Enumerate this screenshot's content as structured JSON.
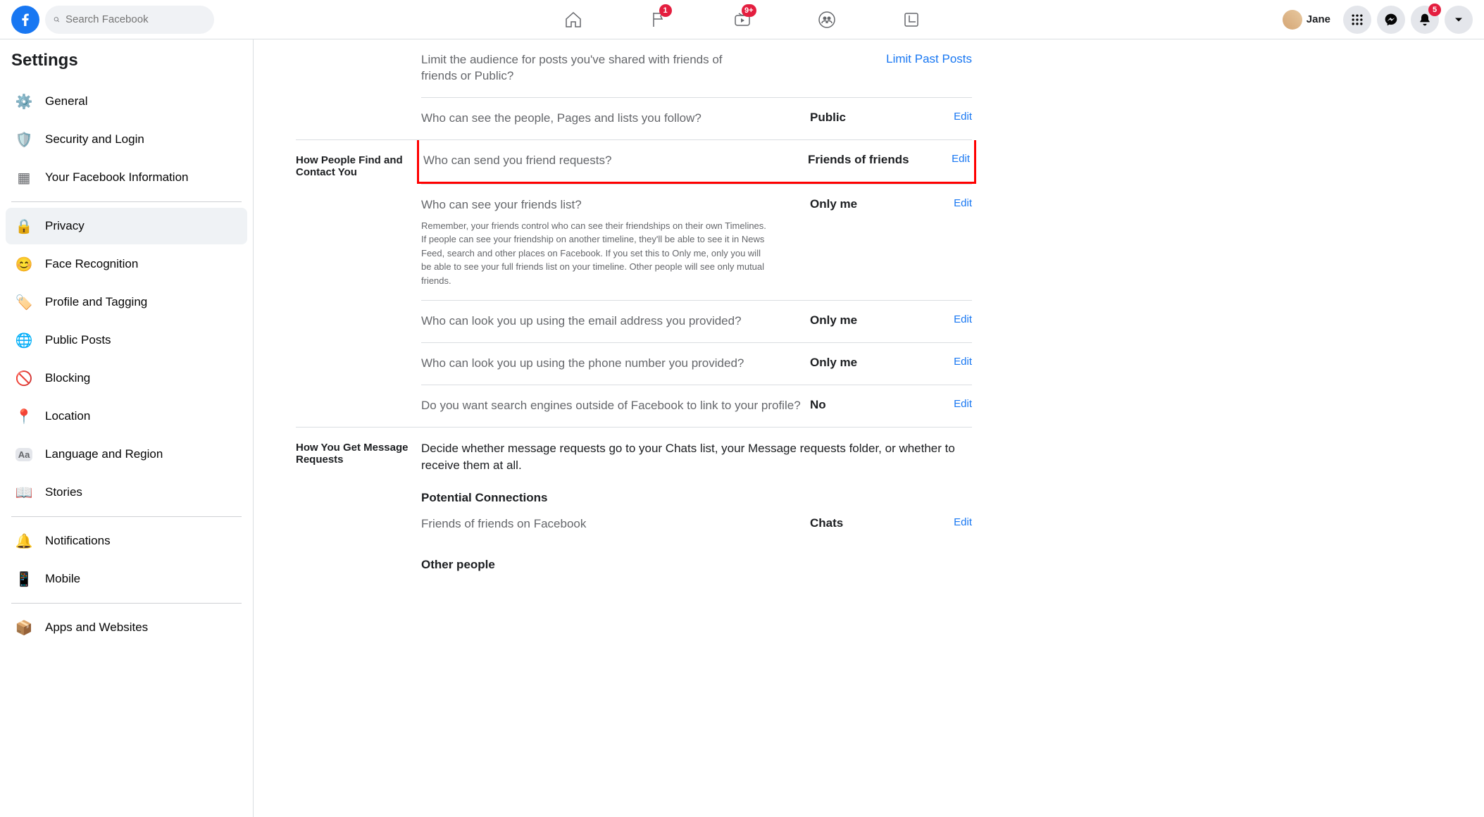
{
  "search": {
    "placeholder": "Search Facebook"
  },
  "badges": {
    "flag": "1",
    "watch": "9+",
    "notifications": "5"
  },
  "profile": {
    "name": "Jane"
  },
  "sidebar": {
    "title": "Settings",
    "items": [
      {
        "label": "General",
        "icon": "gear"
      },
      {
        "label": "Security and Login",
        "icon": "shield"
      },
      {
        "label": "Your Facebook Information",
        "icon": "grid"
      },
      {
        "label": "Privacy",
        "icon": "lock",
        "active": true
      },
      {
        "label": "Face Recognition",
        "icon": "face"
      },
      {
        "label": "Profile and Tagging",
        "icon": "tag"
      },
      {
        "label": "Public Posts",
        "icon": "globe"
      },
      {
        "label": "Blocking",
        "icon": "block"
      },
      {
        "label": "Location",
        "icon": "pin"
      },
      {
        "label": "Language and Region",
        "icon": "aa"
      },
      {
        "label": "Stories",
        "icon": "book"
      },
      {
        "label": "Notifications",
        "icon": "bell"
      },
      {
        "label": "Mobile",
        "icon": "phone"
      },
      {
        "label": "Apps and Websites",
        "icon": "cube"
      }
    ]
  },
  "section_activity": {
    "rows": [
      {
        "label": "Limit the audience for posts you've shared with friends of friends or Public?",
        "value": "",
        "action": "Limit Past Posts"
      },
      {
        "label": "Who can see the people, Pages and lists you follow?",
        "value": "Public",
        "action": "Edit"
      }
    ]
  },
  "section_find": {
    "title": "How People Find and Contact You",
    "rows": [
      {
        "label": "Who can send you friend requests?",
        "value": "Friends of friends",
        "action": "Edit",
        "highlight": true
      },
      {
        "label": "Who can see your friends list?",
        "sub": "Remember, your friends control who can see their friendships on their own Timelines. If people can see your friendship on another timeline, they'll be able to see it in News Feed, search and other places on Facebook. If you set this to Only me, only you will be able to see your full friends list on your timeline. Other people will see only mutual friends.",
        "value": "Only me",
        "action": "Edit"
      },
      {
        "label": "Who can look you up using the email address you provided?",
        "value": "Only me",
        "action": "Edit"
      },
      {
        "label": "Who can look you up using the phone number you provided?",
        "value": "Only me",
        "action": "Edit"
      },
      {
        "label": "Do you want search engines outside of Facebook to link to your profile?",
        "value": "No",
        "action": "Edit"
      }
    ]
  },
  "section_msg": {
    "title": "How You Get Message Requests",
    "desc": "Decide whether message requests go to your Chats list, your Message requests folder, or whether to receive them at all.",
    "sub1": "Potential Connections",
    "rows": [
      {
        "label": "Friends of friends on Facebook",
        "value": "Chats",
        "action": "Edit"
      }
    ],
    "sub2": "Other people"
  }
}
